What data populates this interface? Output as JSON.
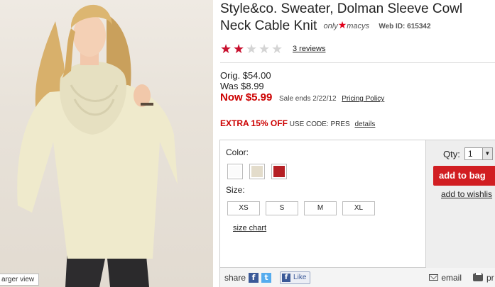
{
  "photo": {
    "larger_view_label": "arger view"
  },
  "product": {
    "title": "Style&co. Sweater, Dolman Sleeve Cowl Neck Cable Knit",
    "brand_prefix": "only",
    "brand_name": "macys",
    "web_id": "Web ID: 615342"
  },
  "rating": {
    "stars_filled": 2,
    "stars_total": 5,
    "reviews_label": "3 reviews"
  },
  "pricing": {
    "orig": "Orig. $54.00",
    "was": "Was $8.99",
    "now": "Now $5.99",
    "sale_ends": "Sale ends 2/22/12",
    "policy_link": "Pricing Policy"
  },
  "promo": {
    "extra": "EXTRA 15% OFF",
    "code": "USE CODE: PRES",
    "details_link": "details"
  },
  "options": {
    "color_label": "Color:",
    "colors": [
      "#fbfbfb",
      "#e3dccb",
      "#b51f24"
    ],
    "size_label": "Size:",
    "sizes": [
      "XS",
      "S",
      "M",
      "XL"
    ],
    "size_chart_link": "size chart"
  },
  "purchase": {
    "qty_label": "Qty:",
    "qty_value": "1",
    "add_to_bag": "add to bag",
    "add_to_wishlist": "add to wishlis"
  },
  "share": {
    "label": "share",
    "like_label": "Like",
    "email_label": "email",
    "print_label": "pr"
  },
  "colors": {
    "accent_red": "#d11e22",
    "price_red": "#cc0000",
    "star_red": "#c8102e",
    "facebook": "#3b5998",
    "twitter": "#55acee"
  }
}
